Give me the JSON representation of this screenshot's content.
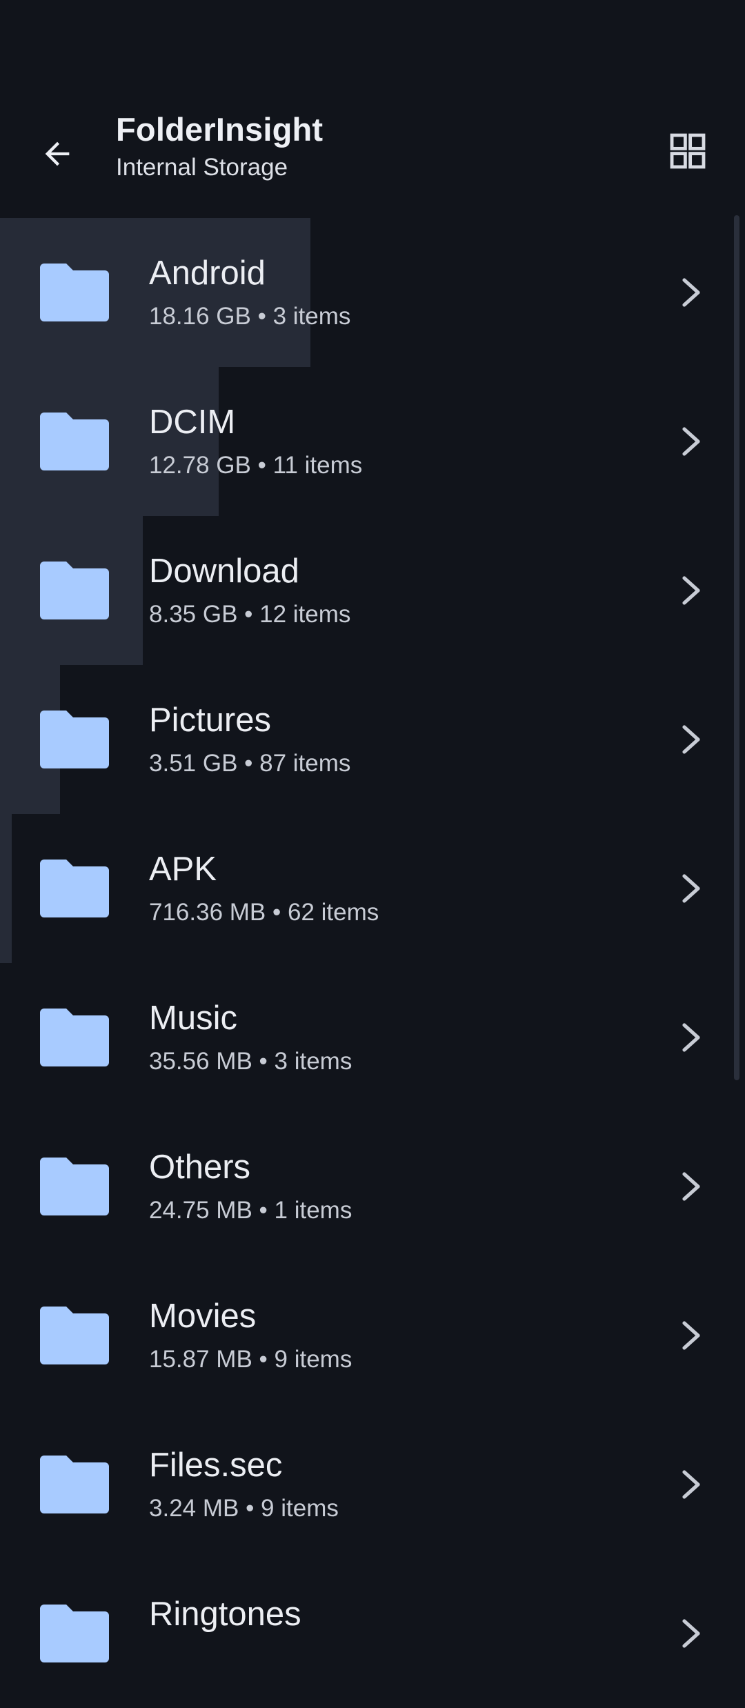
{
  "header": {
    "title": "FolderInsight",
    "subtitle": "Internal Storage",
    "back_icon": "arrow-left-icon",
    "view_toggle_icon": "grid-view-icon"
  },
  "colors": {
    "background": "#11141b",
    "usage_fill": "#262b37",
    "folder_icon": "#a8cbff",
    "chevron": "#c8ccd5"
  },
  "folders": [
    {
      "name": "Android",
      "meta": "18.16 GB • 3 items"
    },
    {
      "name": "DCIM",
      "meta": "12.78 GB • 11 items"
    },
    {
      "name": "Download",
      "meta": "8.35 GB • 12 items"
    },
    {
      "name": "Pictures",
      "meta": "3.51 GB • 87 items"
    },
    {
      "name": "APK",
      "meta": "716.36 MB • 62 items"
    },
    {
      "name": "Music",
      "meta": "35.56 MB • 3 items"
    },
    {
      "name": "Others",
      "meta": "24.75 MB • 1 items"
    },
    {
      "name": "Movies",
      "meta": "15.87 MB • 9 items"
    },
    {
      "name": "Files.sec",
      "meta": "3.24 MB • 9 items"
    },
    {
      "name": "Ringtones",
      "meta": ""
    }
  ]
}
